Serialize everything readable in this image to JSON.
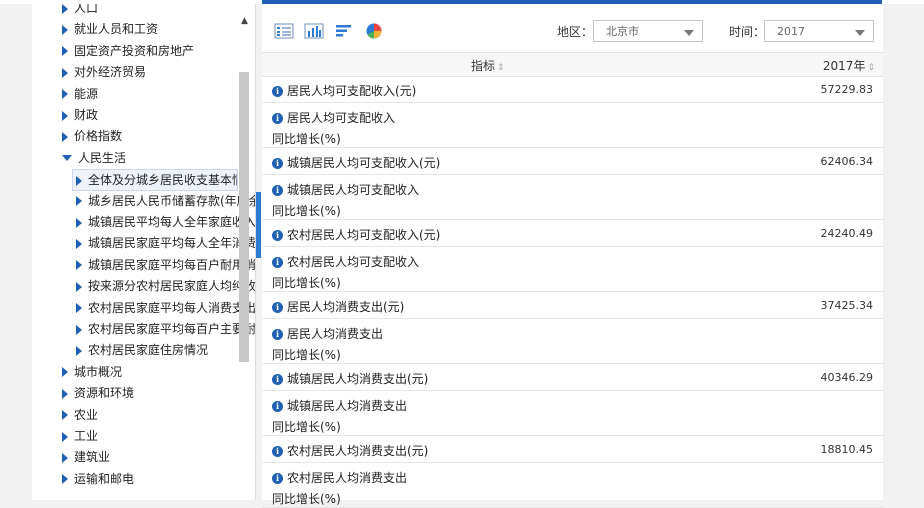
{
  "tree": {
    "items": [
      {
        "label": "人口",
        "expanded": false,
        "level": 0
      },
      {
        "label": "就业人员和工资",
        "expanded": false,
        "level": 0
      },
      {
        "label": "固定资产投资和房地产",
        "expanded": false,
        "level": 0
      },
      {
        "label": "对外经济贸易",
        "expanded": false,
        "level": 0
      },
      {
        "label": "能源",
        "expanded": false,
        "level": 0
      },
      {
        "label": "财政",
        "expanded": false,
        "level": 0
      },
      {
        "label": "价格指数",
        "expanded": false,
        "level": 0
      },
      {
        "label": "人民生活",
        "expanded": true,
        "level": 0
      },
      {
        "label": "全体及分城乡居民收支基本情况",
        "expanded": false,
        "level": 1,
        "selected": true
      },
      {
        "label": "城乡居民人民币储蓄存款(年底余额)",
        "expanded": false,
        "level": 1
      },
      {
        "label": "城镇居民平均每人全年家庭收入来源",
        "expanded": false,
        "level": 1
      },
      {
        "label": "城镇居民家庭平均每人全年消费性支出",
        "expanded": false,
        "level": 1
      },
      {
        "label": "城镇居民家庭平均每百户耐用消费品拥有量",
        "expanded": false,
        "level": 1
      },
      {
        "label": "按来源分农村居民家庭人均纯收入",
        "expanded": false,
        "level": 1
      },
      {
        "label": "农村居民家庭平均每人消费支出",
        "expanded": false,
        "level": 1
      },
      {
        "label": "农村居民家庭平均每百户主要耐用消费品拥有量",
        "expanded": false,
        "level": 1
      },
      {
        "label": "农村居民家庭住房情况",
        "expanded": false,
        "level": 1
      },
      {
        "label": "城市概况",
        "expanded": false,
        "level": 0
      },
      {
        "label": "资源和环境",
        "expanded": false,
        "level": 0
      },
      {
        "label": "农业",
        "expanded": false,
        "level": 0
      },
      {
        "label": "工业",
        "expanded": false,
        "level": 0
      },
      {
        "label": "建筑业",
        "expanded": false,
        "level": 0
      },
      {
        "label": "运输和邮电",
        "expanded": false,
        "level": 0
      }
    ]
  },
  "toolbar": {
    "icons": [
      "table-view-icon",
      "bar-chart-icon",
      "horizontal-bar-icon",
      "pie-chart-icon"
    ],
    "region_label": "地区：",
    "region_value": "北京市",
    "time_label": "时间：",
    "time_value": "2017"
  },
  "table": {
    "col_indicator": "指标",
    "col_year": "2017年",
    "rows": [
      {
        "label": "居民人均可支配收入(元)",
        "value": "57229.83",
        "info": true
      },
      {
        "label": "居民人均可支配收入",
        "sub": "同比增长(%)",
        "value": "",
        "info": true
      },
      {
        "label": "城镇居民人均可支配收入(元)",
        "value": "62406.34",
        "info": true
      },
      {
        "label": "城镇居民人均可支配收入",
        "sub": "同比增长(%)",
        "value": "",
        "info": true
      },
      {
        "label": "农村居民人均可支配收入(元)",
        "value": "24240.49",
        "info": true
      },
      {
        "label": "农村居民人均可支配收入",
        "sub": "同比增长(%)",
        "value": "",
        "info": true
      },
      {
        "label": "居民人均消费支出(元)",
        "value": "37425.34",
        "info": true
      },
      {
        "label": "居民人均消费支出",
        "sub": "同比增长(%)",
        "value": "",
        "info": true
      },
      {
        "label": "城镇居民人均消费支出(元)",
        "value": "40346.29",
        "info": true
      },
      {
        "label": "城镇居民人均消费支出",
        "sub": "同比增长(%)",
        "value": "",
        "info": true
      },
      {
        "label": "农村居民人均消费支出(元)",
        "value": "18810.45",
        "info": true
      },
      {
        "label": "农村居民人均消费支出",
        "sub": "同比增长(%)",
        "value": "",
        "info": true
      }
    ]
  },
  "colors": {
    "accent": "#1f5fb4",
    "scrollbar": "#c8c8c8",
    "splitter": "#2e7bd6"
  }
}
